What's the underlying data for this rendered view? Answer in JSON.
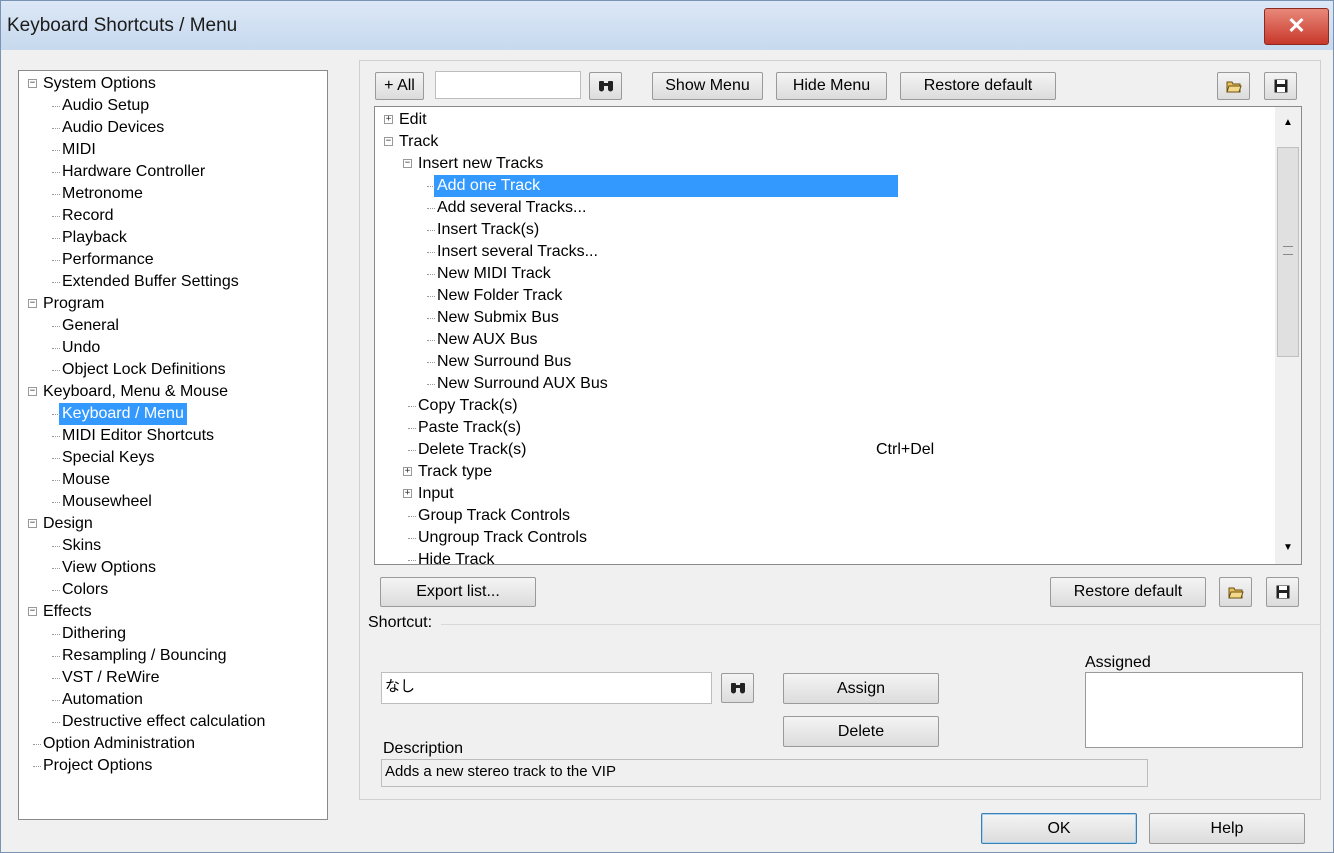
{
  "window": {
    "title": "Keyboard Shortcuts / Menu",
    "close_label": "✕"
  },
  "left_tree": [
    {
      "label": "System Options",
      "level": 0,
      "expander": "−"
    },
    {
      "label": "Audio Setup",
      "level": 1
    },
    {
      "label": "Audio Devices",
      "level": 1
    },
    {
      "label": "MIDI",
      "level": 1
    },
    {
      "label": "Hardware Controller",
      "level": 1
    },
    {
      "label": "Metronome",
      "level": 1
    },
    {
      "label": "Record",
      "level": 1
    },
    {
      "label": "Playback",
      "level": 1
    },
    {
      "label": "Performance",
      "level": 1
    },
    {
      "label": "Extended Buffer Settings",
      "level": 1
    },
    {
      "label": "Program",
      "level": 0,
      "expander": "−"
    },
    {
      "label": "General",
      "level": 1
    },
    {
      "label": "Undo",
      "level": 1
    },
    {
      "label": "Object Lock Definitions",
      "level": 1
    },
    {
      "label": "Keyboard, Menu & Mouse",
      "level": 0,
      "expander": "−"
    },
    {
      "label": "Keyboard / Menu",
      "level": 1,
      "selected": true
    },
    {
      "label": "MIDI Editor Shortcuts",
      "level": 1
    },
    {
      "label": "Special Keys",
      "level": 1
    },
    {
      "label": "Mouse",
      "level": 1
    },
    {
      "label": "Mousewheel",
      "level": 1
    },
    {
      "label": "Design",
      "level": 0,
      "expander": "−"
    },
    {
      "label": "Skins",
      "level": 1
    },
    {
      "label": "View Options",
      "level": 1
    },
    {
      "label": "Colors",
      "level": 1
    },
    {
      "label": "Effects",
      "level": 0,
      "expander": "−"
    },
    {
      "label": "Dithering",
      "level": 1
    },
    {
      "label": "Resampling / Bouncing",
      "level": 1
    },
    {
      "label": "VST / ReWire",
      "level": 1
    },
    {
      "label": "Automation",
      "level": 1
    },
    {
      "label": "Destructive effect calculation",
      "level": 1
    },
    {
      "label": "Option Administration",
      "level": 0
    },
    {
      "label": "Project Options",
      "level": 0
    }
  ],
  "toolbar": {
    "all_label": "+ All",
    "search_value": "",
    "search_icon": "binoculars-icon",
    "show_menu_label": "Show Menu",
    "hide_menu_label": "Hide Menu",
    "restore_default_label": "Restore default",
    "open_icon": "folder-open-icon",
    "save_icon": "floppy-disk-icon"
  },
  "command_tree": [
    {
      "label": "Edit",
      "level": 0,
      "expander": "+"
    },
    {
      "label": "Track",
      "level": 0,
      "expander": "−"
    },
    {
      "label": "Insert new Tracks",
      "level": 1,
      "expander": "−"
    },
    {
      "label": "Add one Track",
      "level": 2,
      "selected": true
    },
    {
      "label": "Add several Tracks...",
      "level": 2
    },
    {
      "label": "Insert Track(s)",
      "level": 2
    },
    {
      "label": "Insert several Tracks...",
      "level": 2
    },
    {
      "label": "New MIDI Track",
      "level": 2
    },
    {
      "label": "New Folder Track",
      "level": 2
    },
    {
      "label": "New Submix Bus",
      "level": 2
    },
    {
      "label": "New AUX Bus",
      "level": 2
    },
    {
      "label": "New Surround Bus",
      "level": 2
    },
    {
      "label": "New Surround AUX Bus",
      "level": 2
    },
    {
      "label": "Copy Track(s)",
      "level": 1
    },
    {
      "label": "Paste Track(s)",
      "level": 1
    },
    {
      "label": "Delete Track(s)",
      "level": 1,
      "shortcut": "Ctrl+Del"
    },
    {
      "label": "Track type",
      "level": 1,
      "expander": "+"
    },
    {
      "label": "Input",
      "level": 1,
      "expander": "+"
    },
    {
      "label": "Group Track Controls",
      "level": 1
    },
    {
      "label": "Ungroup Track Controls",
      "level": 1
    },
    {
      "label": "Hide Track",
      "level": 1
    }
  ],
  "bottom": {
    "export_label": "Export list...",
    "restore_default_label": "Restore default",
    "shortcut_label": "Shortcut:",
    "shortcut_value": "なし",
    "assign_label": "Assign",
    "delete_label": "Delete",
    "assigned_label": "Assigned",
    "description_label": "Description",
    "description_value": "Adds a new stereo track to the VIP"
  },
  "footer": {
    "ok_label": "OK",
    "help_label": "Help"
  },
  "colors": {
    "selection": "#3399ff",
    "title_bar": "#c7d9ee",
    "close_button": "#c7382a"
  }
}
